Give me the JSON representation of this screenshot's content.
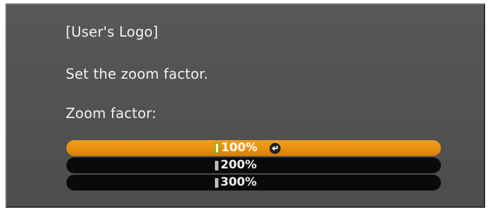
{
  "dialog": {
    "title": "[User's Logo]",
    "instruction": "Set the zoom factor.",
    "field_label": "Zoom factor:"
  },
  "zoom_options": [
    {
      "label": "100%",
      "selected": true
    },
    {
      "label": "200%",
      "selected": false
    },
    {
      "label": "300%",
      "selected": false
    }
  ],
  "icons": {
    "selected_marker": "selection-marker-icon",
    "enter": "enter-icon"
  },
  "colors": {
    "panel": "#555555",
    "highlight": "#e98f0c",
    "option_background": "#0a0a0a",
    "text": "#f2f2f2"
  }
}
